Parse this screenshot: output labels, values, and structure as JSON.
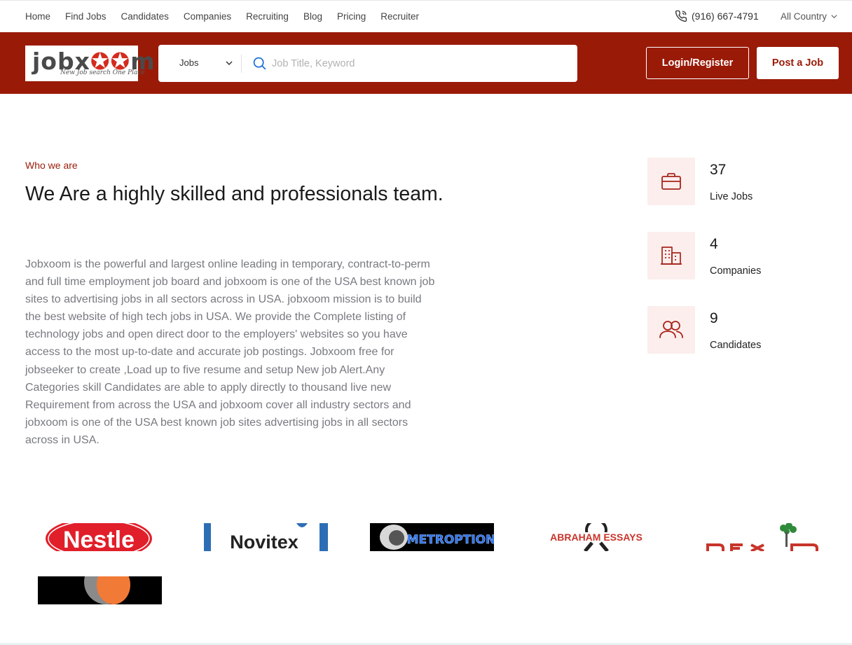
{
  "topnav": {
    "items": [
      "Home",
      "Find Jobs",
      "Candidates",
      "Companies",
      "Recruiting",
      "Blog",
      "Pricing",
      "Recruiter"
    ],
    "phone": "(916) 667-4791",
    "country": "All Country"
  },
  "header": {
    "logo_text": "jobxoom",
    "logo_tagline": "New Job search One Place",
    "search_type": "Jobs",
    "search_placeholder": "Job Title, Keyword",
    "login_label": "Login/Register",
    "post_label": "Post a Job"
  },
  "about": {
    "eyebrow": "Who we are",
    "headline": "We Are a highly skilled and professionals team.",
    "body": "Jobxoom is the powerful and largest online leading in temporary, contract-to-perm and full time employment job board and jobxoom is one of the USA best known job sites to advertising jobs in all sectors across in USA. jobxoom mission is to build the best website of high tech jobs in USA. We provide the Complete listing of technology jobs and open direct door to the employers' websites so you have access to the most up-to-date and accurate job postings. Jobxoom free for jobseeker to create ,Load up to five resume and setup New job Alert.Any Categories skill Candidates are able to apply directly to thousand live new Requirement from across the USA and jobxoom cover all industry sectors and jobxoom is one of the USA best known job sites advertising jobs in all sectors across in USA."
  },
  "stats": [
    {
      "value": "37",
      "label": "Live Jobs",
      "icon": "briefcase-icon"
    },
    {
      "value": "4",
      "label": "Companies",
      "icon": "building-icon"
    },
    {
      "value": "9",
      "label": "Candidates",
      "icon": "users-icon"
    }
  ],
  "brands": [
    "Nestle",
    "Novitex",
    "METROPTION",
    "ABRAHAM ESSAYS"
  ],
  "colors": {
    "brand": "#9a1a08",
    "icon_bg": "#fbeeed",
    "body_text": "#777a80"
  }
}
